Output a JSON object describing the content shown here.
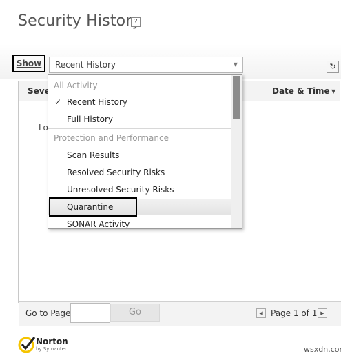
{
  "header": {
    "title": "Security History",
    "help_label": "?"
  },
  "toolbar": {
    "show_label": "Show",
    "select_value": "Recent History",
    "refresh_glyph": "↻"
  },
  "table": {
    "col_severity": "Seve",
    "col_date": "Date & Time",
    "loading_text": "Lo"
  },
  "dropdown": {
    "group_all": "All Activity",
    "recent": "Recent History",
    "full": "Full History",
    "group_protection": "Protection and Performance",
    "scan": "Scan Results",
    "resolved": "Resolved Security Risks",
    "unresolved": "Unresolved Security Risks",
    "quarantine": "Quarantine",
    "sonar": "SONAR Activity",
    "check_glyph": "✓"
  },
  "footer": {
    "goto_label": "Go to Page:",
    "go_label": "Go",
    "page_indicator": "Page 1 of 1"
  },
  "brand": {
    "name": "Norton",
    "sub": "by Symantec"
  },
  "watermark": "wsxdn.com",
  "icons": {
    "help": "help-icon",
    "chevron": "chevron-down-icon",
    "refresh": "refresh-icon",
    "sort": "sort-icon",
    "prev": "prev-page-icon",
    "next": "next-page-icon",
    "check": "checkmark-icon"
  },
  "colors": {
    "accent_yellow": "#f5c400",
    "title_gray": "#555555"
  }
}
